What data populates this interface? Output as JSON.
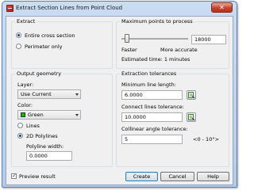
{
  "window": {
    "title": "Extract Section Lines from Point Cloud",
    "close_label": "✕"
  },
  "extract": {
    "title": "Extract",
    "options": [
      "Entire cross section",
      "Perimeter only"
    ],
    "selected": "Entire cross section"
  },
  "max_points": {
    "title": "Maximum points to process",
    "value": "18000",
    "slider_level": 0.05,
    "min_label": "Faster",
    "max_label": "More accurate",
    "estimate": "Estimated time: 1 minutes"
  },
  "output": {
    "title": "Output geometry",
    "layer_label": "Layer:",
    "layer_value": "Use Current",
    "color_label": "Color:",
    "color_value": "Green",
    "color_swatch": "#00c000",
    "geometry_options": [
      "Lines",
      "2D Polylines"
    ],
    "selected_geometry": "2D Polylines",
    "polyline_width_label": "Polyline width:",
    "polyline_width_value": "0.0000"
  },
  "tolerances": {
    "title": "Extraction tolerances",
    "min_length_label": "Minimum line length:",
    "min_length_value": "6.0000",
    "connect_label": "Connect lines tolerance:",
    "connect_value": "10.0000",
    "collinear_label": "Collinear angle tolerance:",
    "collinear_value": "5",
    "collinear_range": "<0 - 10°>",
    "pick_icon": "pick-point-icon"
  },
  "preview": {
    "label": "Preview result",
    "checked": true,
    "check_glyph": "✓"
  },
  "buttons": {
    "create": "Create",
    "cancel": "Cancel",
    "help": "Help"
  }
}
